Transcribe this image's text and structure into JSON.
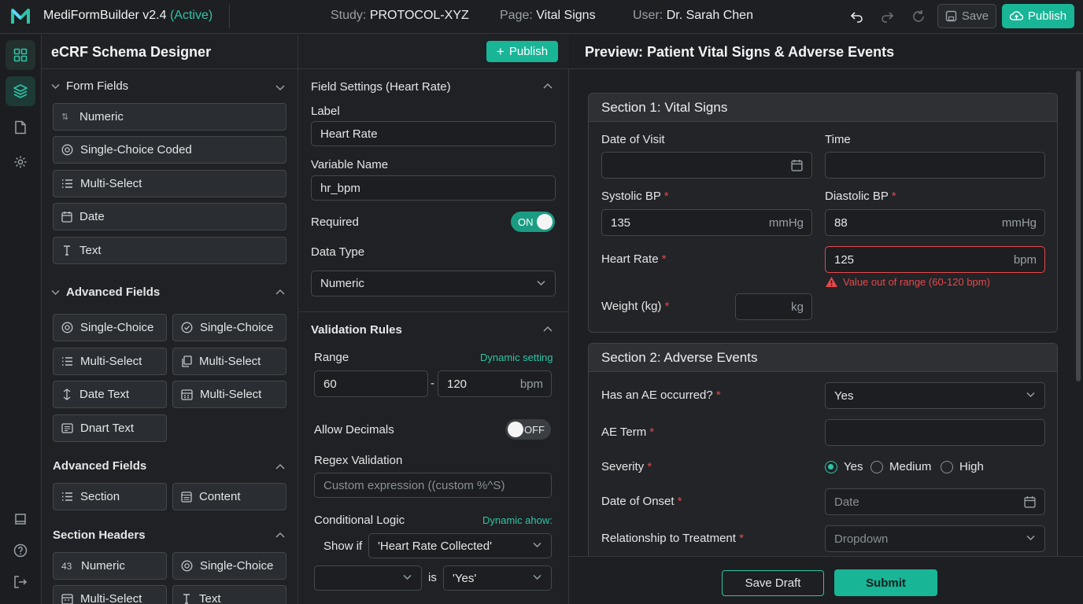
{
  "app": {
    "name": "MediFormBuilder v2.4",
    "status": "(Active)",
    "study_label": "Study:",
    "study": "PROTOCOL-XYZ",
    "page_label": "Page:",
    "page": "Vital Signs",
    "user_label": "User:",
    "user": "Dr. Sarah Chen",
    "save": "Save",
    "publish": "Publish",
    "accent": "#18b597"
  },
  "designer": {
    "title": "eCRF Schema Designer",
    "publish": "Publish"
  },
  "left": {
    "form_fields": {
      "title": "Form Fields",
      "items": [
        {
          "label": "Numeric",
          "icon": "numeric-icon"
        },
        {
          "label": "Single-Choice Coded",
          "icon": "radio-icon"
        },
        {
          "label": "Multi-Select",
          "icon": "list-icon"
        },
        {
          "label": "Date",
          "icon": "calendar-icon"
        },
        {
          "label": "Text",
          "icon": "text-icon"
        }
      ]
    },
    "advanced1": {
      "title": "Advanced Fields",
      "items": [
        {
          "label": "Single-Choice",
          "icon": "radio-icon"
        },
        {
          "label": "Single-Choice",
          "icon": "check-circle-icon"
        },
        {
          "label": "Multi-Select",
          "icon": "list-icon"
        },
        {
          "label": "Multi-Select",
          "icon": "copy-icon"
        },
        {
          "label": "Date Text",
          "icon": "date-text-icon"
        },
        {
          "label": "Multi-Select",
          "icon": "grid-icon"
        },
        {
          "label": "Dnart Text",
          "icon": "textbox-icon"
        }
      ]
    },
    "advanced2": {
      "title": "Advanced Fields",
      "items": [
        {
          "label": "Section",
          "icon": "list-icon"
        },
        {
          "label": "Content",
          "icon": "content-icon"
        }
      ]
    },
    "section_headers": {
      "title": "Section Headers",
      "items": [
        {
          "label": "Numeric",
          "icon": "43"
        },
        {
          "label": "Single-Choice",
          "icon": "radio-icon"
        },
        {
          "label": "Multi-Select",
          "icon": "grid-icon"
        },
        {
          "label": "Text",
          "icon": "text-icon"
        }
      ]
    }
  },
  "settings": {
    "title": "Field Settings (Heart Rate)",
    "label_label": "Label",
    "label_value": "Heart Rate",
    "var_label": "Variable Name",
    "var_value": "hr_bpm",
    "required_label": "Required",
    "required_toggle": "ON",
    "datatype_label": "Data Type",
    "datatype_value": "Numeric",
    "validation_title": "Validation Rules",
    "range_label": "Range",
    "range_hint": "Dynamic setting",
    "range_min": "60",
    "range_dash": "-",
    "range_max": "120",
    "range_unit": "bpm",
    "decimals_label": "Allow Decimals",
    "decimals_toggle": "OFF",
    "regex_label": "Regex Validation",
    "regex_placeholder": "Custom expression ((custom %^S)",
    "cond_label": "Conditional Logic",
    "cond_hint": "Dynamic ahow:",
    "showif_label": "Show if",
    "showif_value": "'Heart Rate Collected'",
    "is_label": "is",
    "is_value": "'Yes'"
  },
  "preview": {
    "title": "Preview: Patient Vital Signs & Adverse Events",
    "s1": {
      "title": "Section 1: Vital Signs",
      "date_visit": "Date of Visit",
      "time": "Time",
      "systolic": "Systolic BP",
      "systolic_value": "135",
      "systolic_unit": "mmHg",
      "diastolic": "Diastolic BP",
      "diastolic_value": "88",
      "diastolic_unit": "mmHg",
      "hr": "Heart Rate",
      "hr_value": "125",
      "hr_unit": "bpm",
      "hr_error": "Value out of range (60-120 bpm)",
      "weight": "Weight (kg)",
      "weight_unit": "kg"
    },
    "s2": {
      "title": "Section 2: Adverse Events",
      "ae_occ": "Has an AE occurred?",
      "ae_occ_value": "Yes",
      "ae_term": "AE Term",
      "severity": "Severity",
      "sev_opts": [
        "Yes",
        "Medium",
        "High"
      ],
      "onset": "Date of Onset",
      "onset_placeholder": "Date",
      "relation": "Relationship to Treatment",
      "relation_placeholder": "Dropdown"
    },
    "save_draft": "Save Draft",
    "submit": "Submit",
    "asterisk": "*"
  }
}
